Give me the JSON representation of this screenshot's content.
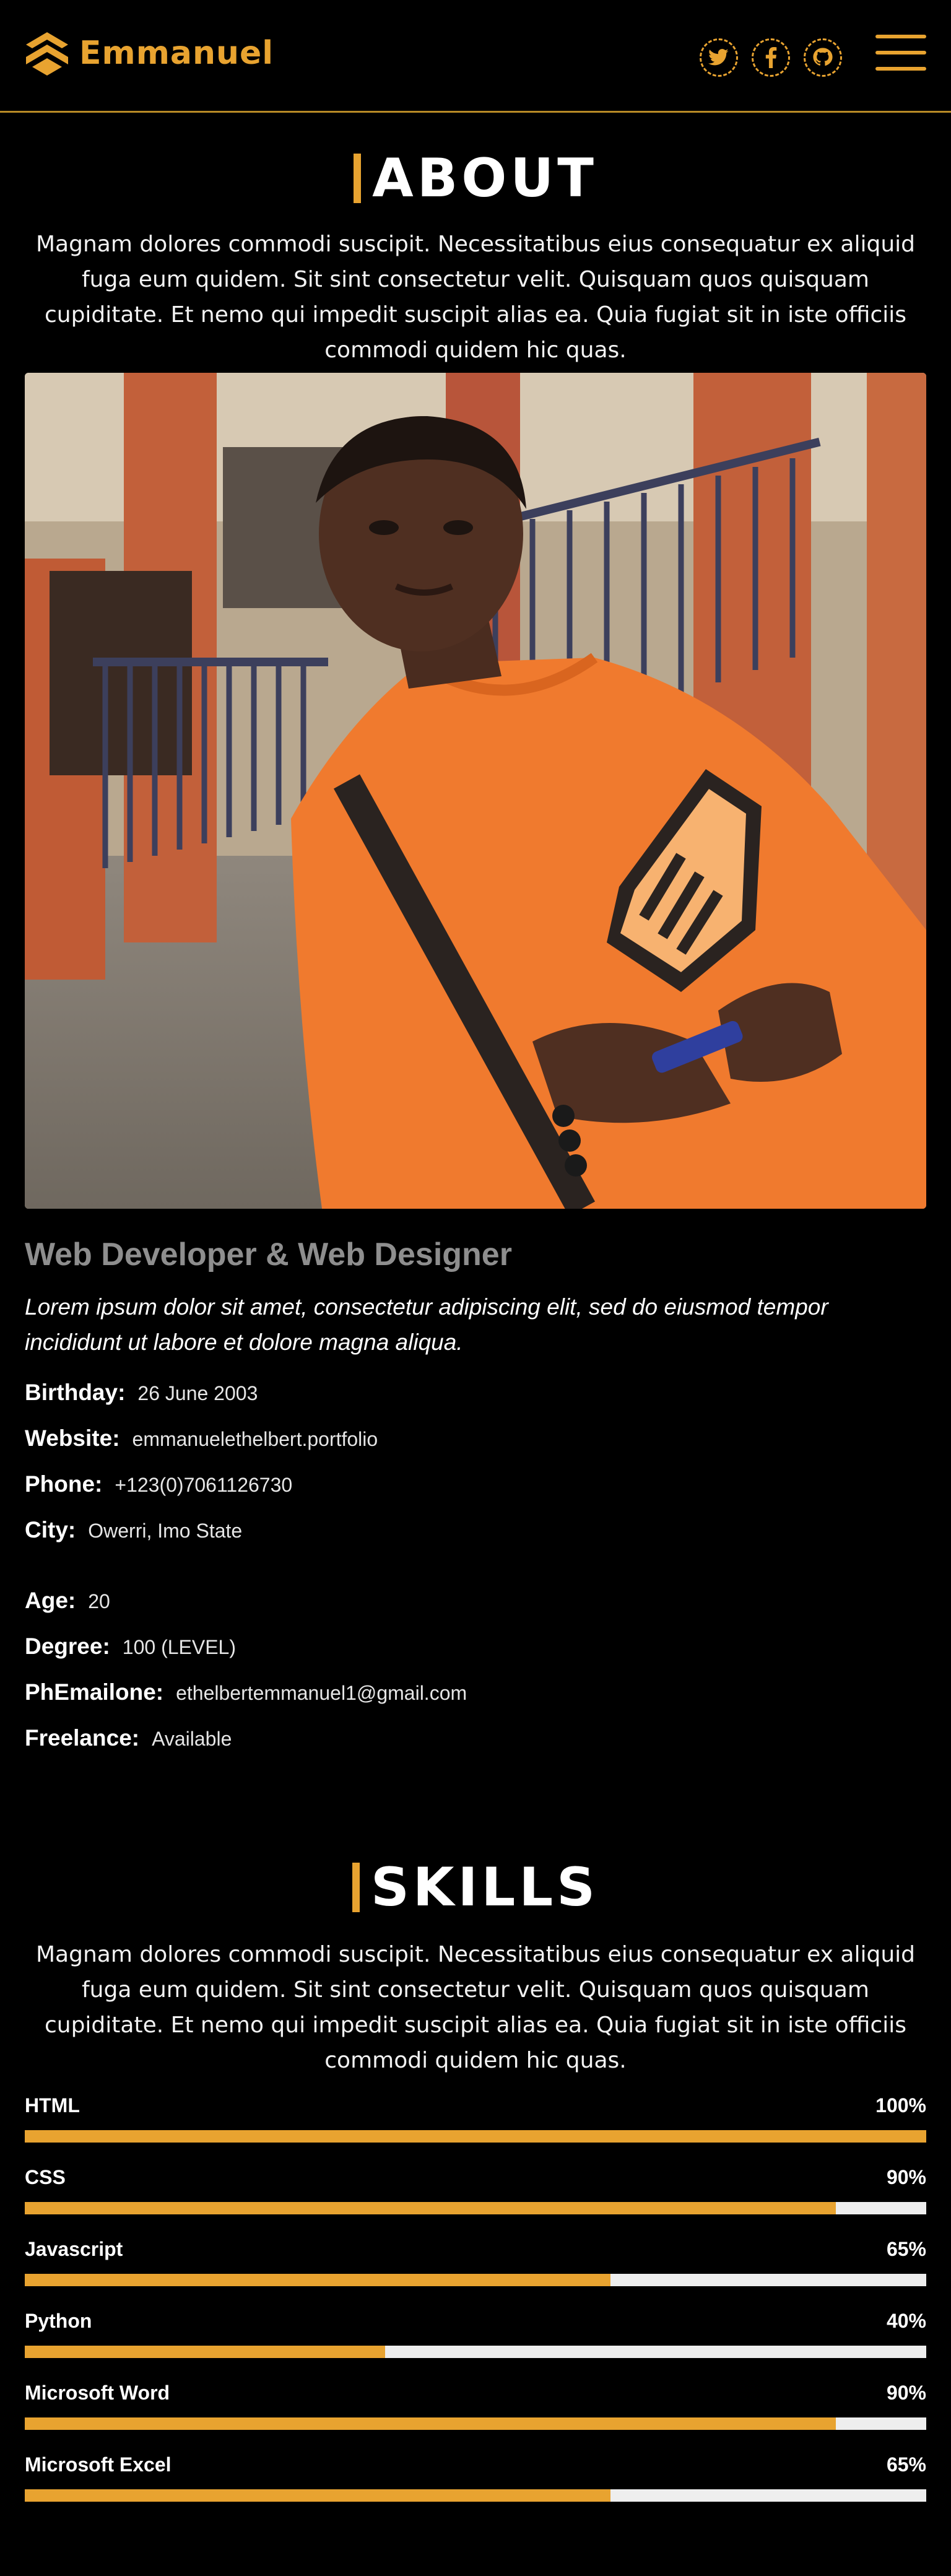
{
  "header": {
    "brand": "Emmanuel",
    "socials": [
      {
        "icon": "twitter-icon"
      },
      {
        "icon": "facebook-icon"
      },
      {
        "icon": "github-icon"
      }
    ],
    "menu_icon": "hamburger-menu-icon"
  },
  "colors": {
    "accent": "#e8a330",
    "background": "#000000",
    "track": "#eeeeee",
    "muted": "#8e8e8e"
  },
  "about": {
    "title": "ABOUT",
    "description": "Magnam dolores commodi suscipit. Necessitatibus eius consequatur ex aliquid fuga eum quidem. Sit sint consectetur velit. Quisquam quos quisquam cupiditate. Et nemo qui impedit suscipit alias ea. Quia fugiat sit in iste officiis commodi quidem hic quas.",
    "role": "Web Developer & Web Designer",
    "lead": "Lorem ipsum dolor sit amet, consectetur adipiscing elit, sed do eiusmod tempor incididunt ut labore et dolore magna aliqua.",
    "info_left": [
      {
        "key": "Birthday:",
        "value": "26 June 2003"
      },
      {
        "key": "Website:",
        "value": "emmanuelethelbert.portfolio"
      },
      {
        "key": "Phone:",
        "value": "+123(0)7061126730"
      },
      {
        "key": "City:",
        "value": "Owerri, Imo State"
      }
    ],
    "info_right": [
      {
        "key": "Age:",
        "value": "20"
      },
      {
        "key": "Degree:",
        "value": "100 (LEVEL)"
      },
      {
        "key": "PhEmailone:",
        "value": "ethelbertemmanuel1@gmail.com"
      },
      {
        "key": "Freelance:",
        "value": "Available"
      }
    ]
  },
  "skills": {
    "title": "SKILLS",
    "description": "Magnam dolores commodi suscipit. Necessitatibus eius consequatur ex aliquid fuga eum quidem. Sit sint consectetur velit. Quisquam quos quisquam cupiditate. Et nemo qui impedit suscipit alias ea. Quia fugiat sit in iste officiis commodi quidem hic quas.",
    "items": [
      {
        "name": "HTML",
        "label": "100%",
        "level": 100
      },
      {
        "name": "CSS",
        "label": "90%",
        "level": 90
      },
      {
        "name": "Javascript",
        "label": "65%",
        "level": 65
      },
      {
        "name": "Python",
        "label": "40%",
        "level": 40
      },
      {
        "name": "Microsoft Word",
        "label": "90%",
        "level": 90
      },
      {
        "name": "Microsoft Excel",
        "label": "65%",
        "level": 65
      }
    ]
  }
}
